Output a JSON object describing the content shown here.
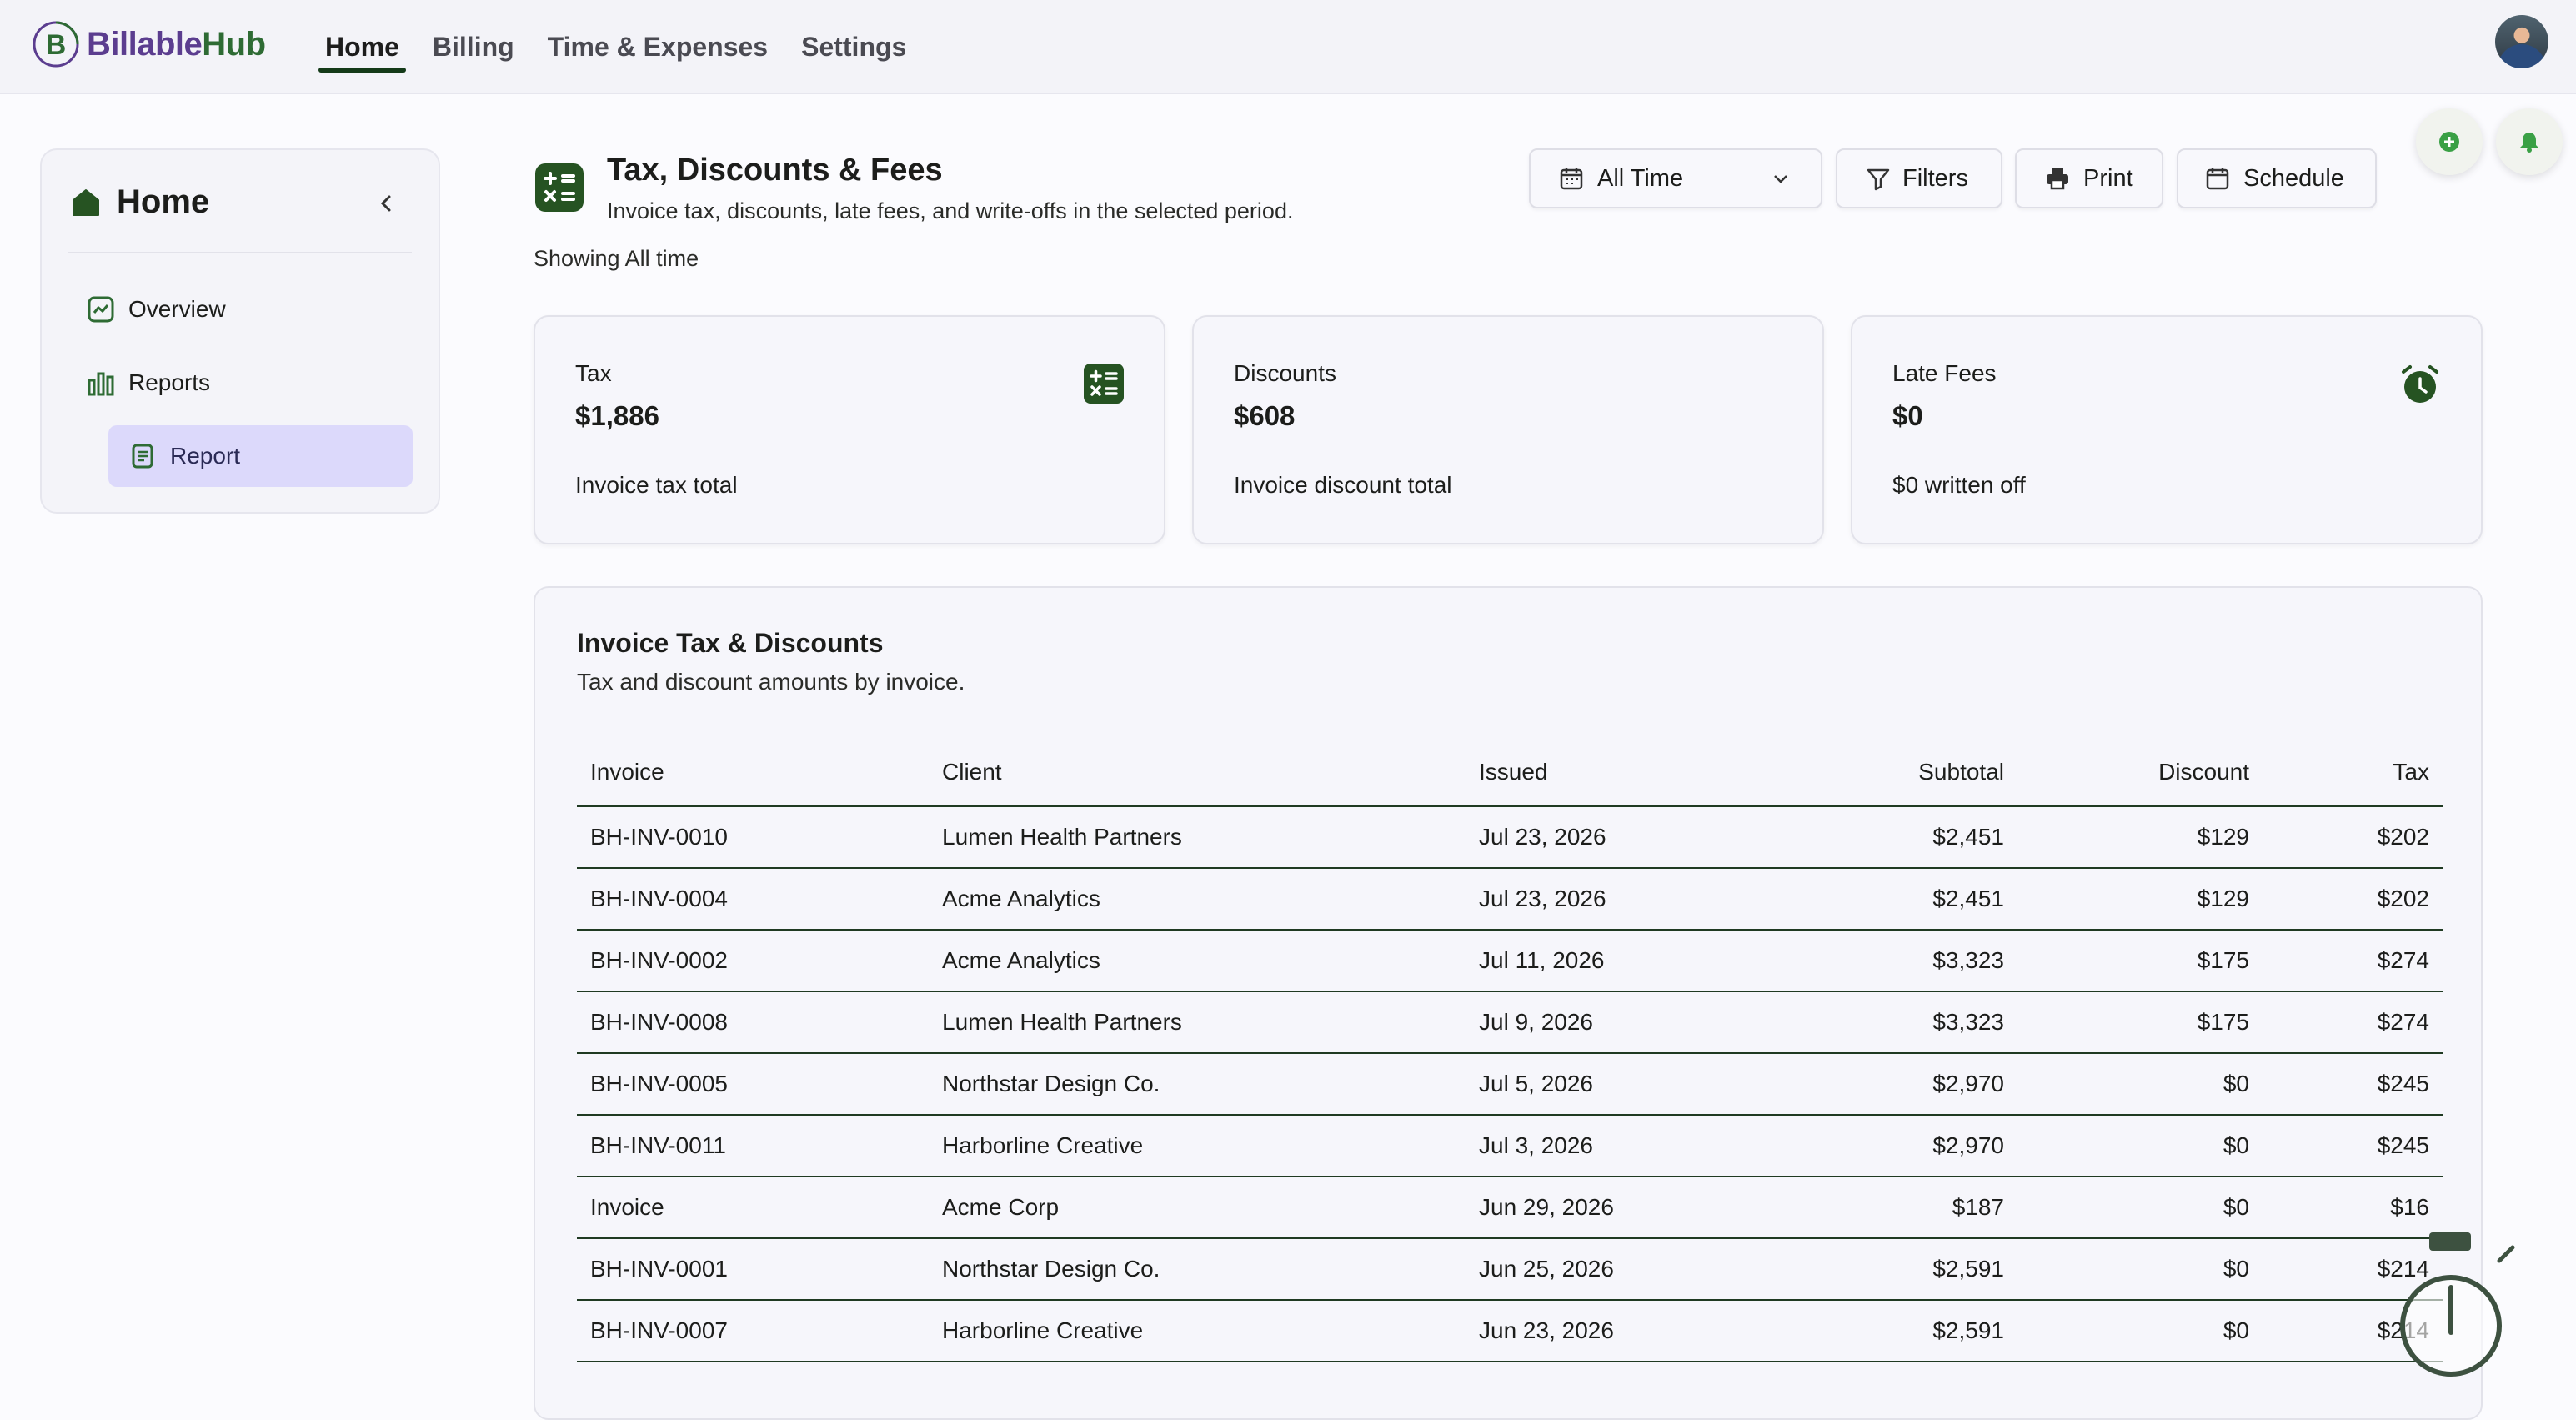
{
  "brand": {
    "part1": "Billable",
    "part2": "Hub",
    "mark_letter": "B"
  },
  "nav": {
    "items": [
      {
        "label": "Home",
        "active": true
      },
      {
        "label": "Billing"
      },
      {
        "label": "Time & Expenses"
      },
      {
        "label": "Settings"
      }
    ]
  },
  "sidebar": {
    "title": "Home",
    "items": [
      {
        "label": "Overview"
      },
      {
        "label": "Reports"
      }
    ],
    "sub_item": {
      "label": "Report"
    }
  },
  "header": {
    "title": "Tax, Discounts & Fees",
    "subtitle": "Invoice tax, discounts, late fees, and write-offs in the selected period.",
    "showing": "Showing All time"
  },
  "toolbar": {
    "period": "All Time",
    "filters": "Filters",
    "print": "Print",
    "schedule": "Schedule"
  },
  "cards": [
    {
      "label": "Tax",
      "value": "$1,886",
      "caption": "Invoice tax total",
      "icon": "calculator-icon"
    },
    {
      "label": "Discounts",
      "value": "$608",
      "caption": "Invoice discount total"
    },
    {
      "label": "Late Fees",
      "value": "$0",
      "caption": "$0 written off",
      "icon": "alarm-clock-icon"
    }
  ],
  "table": {
    "title": "Invoice Tax & Discounts",
    "subtitle": "Tax and discount amounts by invoice.",
    "columns": [
      "Invoice",
      "Client",
      "Issued",
      "Subtotal",
      "Discount",
      "Tax"
    ],
    "rows": [
      [
        "BH-INV-0010",
        "Lumen Health Partners",
        "Jul 23, 2026",
        "$2,451",
        "$129",
        "$202"
      ],
      [
        "BH-INV-0004",
        "Acme Analytics",
        "Jul 23, 2026",
        "$2,451",
        "$129",
        "$202"
      ],
      [
        "BH-INV-0002",
        "Acme Analytics",
        "Jul 11, 2026",
        "$3,323",
        "$175",
        "$274"
      ],
      [
        "BH-INV-0008",
        "Lumen Health Partners",
        "Jul 9, 2026",
        "$3,323",
        "$175",
        "$274"
      ],
      [
        "BH-INV-0005",
        "Northstar Design Co.",
        "Jul 5, 2026",
        "$2,970",
        "$0",
        "$245"
      ],
      [
        "BH-INV-0011",
        "Harborline Creative",
        "Jul 3, 2026",
        "$2,970",
        "$0",
        "$245"
      ],
      [
        "Invoice",
        "Acme Corp",
        "Jun 29, 2026",
        "$187",
        "$0",
        "$16"
      ],
      [
        "BH-INV-0001",
        "Northstar Design Co.",
        "Jun 25, 2026",
        "$2,591",
        "$0",
        "$214"
      ],
      [
        "BH-INV-0007",
        "Harborline Creative",
        "Jun 23, 2026",
        "$2,591",
        "$0",
        "$214"
      ]
    ]
  },
  "colors": {
    "accent": "#265322",
    "sidebar_active": "#dcd9fb",
    "brand_purple": "#5b3d8f",
    "brand_green": "#2e6b34"
  }
}
